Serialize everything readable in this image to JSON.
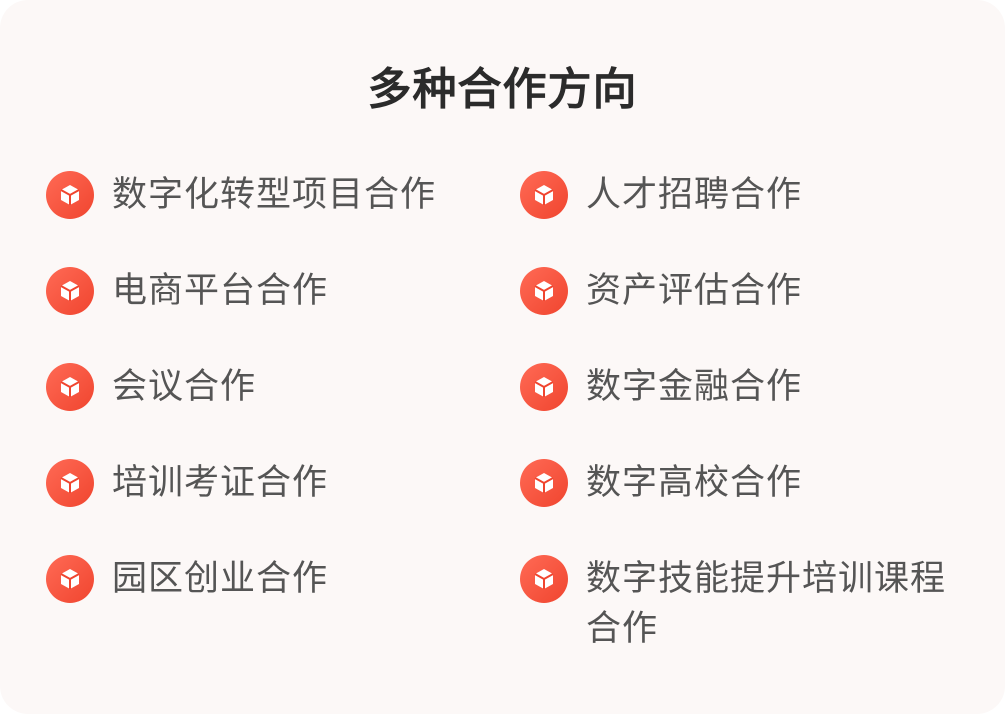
{
  "title": "多种合作方向",
  "left_items": [
    {
      "label": "数字化转型项目合作"
    },
    {
      "label": "电商平台合作"
    },
    {
      "label": "会议合作"
    },
    {
      "label": "培训考证合作"
    },
    {
      "label": "园区创业合作"
    }
  ],
  "right_items": [
    {
      "label": "人才招聘合作"
    },
    {
      "label": "资产评估合作"
    },
    {
      "label": "数字金融合作"
    },
    {
      "label": "数字高校合作"
    },
    {
      "label": "数字技能提升培训课程合作"
    }
  ],
  "colors": {
    "icon": "#f0452f",
    "card_bg": "#fcf8f7",
    "title": "#2b2b2b",
    "text": "#555555"
  },
  "icon_name": "box-icon"
}
